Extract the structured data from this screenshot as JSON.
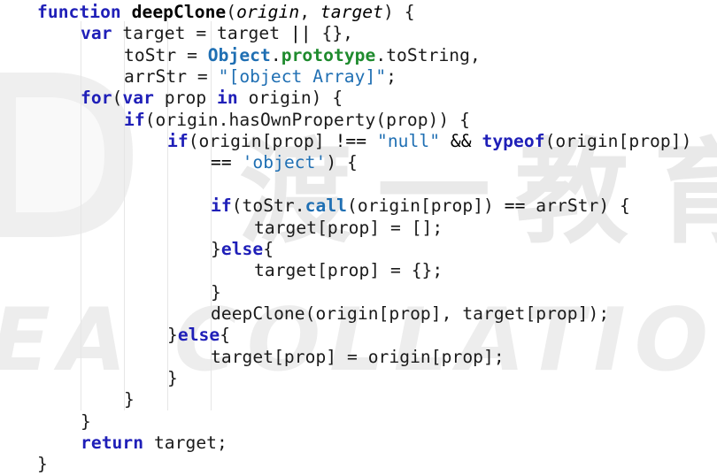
{
  "watermark": {
    "chinese": "渡一教育",
    "latin": "EA COLLATION"
  },
  "colors": {
    "keyword": "#1f1fb8",
    "builtin": "#1f6fb3",
    "property": "#1f8b2e",
    "string": "#1f6fb3",
    "plain": "#1a1a1a"
  },
  "code_lines": [
    {
      "indent": 0,
      "tokens": [
        {
          "t": "function",
          "c": "t-key"
        },
        {
          "t": " ",
          "c": ""
        },
        {
          "t": "deepClone",
          "c": "t-def-name"
        },
        {
          "t": "(",
          "c": ""
        },
        {
          "t": "origin",
          "c": "t-par"
        },
        {
          "t": ", ",
          "c": ""
        },
        {
          "t": "target",
          "c": "t-par"
        },
        {
          "t": ") {",
          "c": ""
        }
      ]
    },
    {
      "indent": 1,
      "tokens": [
        {
          "t": "var",
          "c": "t-key"
        },
        {
          "t": " target = target ",
          "c": ""
        },
        {
          "t": "||",
          "c": "t-op"
        },
        {
          "t": " {},",
          "c": ""
        }
      ]
    },
    {
      "indent": 2,
      "tokens": [
        {
          "t": "toStr = ",
          "c": ""
        },
        {
          "t": "Object",
          "c": "t-obj"
        },
        {
          "t": ".",
          "c": ""
        },
        {
          "t": "prototype",
          "c": "t-prop"
        },
        {
          "t": ".toString,",
          "c": ""
        }
      ]
    },
    {
      "indent": 2,
      "tokens": [
        {
          "t": "arrStr = ",
          "c": ""
        },
        {
          "t": "\"[object Array]\"",
          "c": "t-str"
        },
        {
          "t": ";",
          "c": ""
        }
      ]
    },
    {
      "indent": 1,
      "tokens": [
        {
          "t": "for",
          "c": "t-key"
        },
        {
          "t": "(",
          "c": ""
        },
        {
          "t": "var",
          "c": "t-key"
        },
        {
          "t": " prop ",
          "c": ""
        },
        {
          "t": "in",
          "c": "t-key"
        },
        {
          "t": " origin) {",
          "c": ""
        }
      ]
    },
    {
      "indent": 2,
      "tokens": [
        {
          "t": "if",
          "c": "t-key"
        },
        {
          "t": "(origin.hasOwnProperty(prop)) {",
          "c": ""
        }
      ]
    },
    {
      "indent": 3,
      "tokens": [
        {
          "t": "if",
          "c": "t-key"
        },
        {
          "t": "(origin[prop] ",
          "c": ""
        },
        {
          "t": "!==",
          "c": "t-op"
        },
        {
          "t": " ",
          "c": ""
        },
        {
          "t": "\"null\"",
          "c": "t-str"
        },
        {
          "t": " ",
          "c": ""
        },
        {
          "t": "&&",
          "c": "t-op"
        },
        {
          "t": " ",
          "c": ""
        },
        {
          "t": "typeof",
          "c": "t-key"
        },
        {
          "t": "(origin[prop])",
          "c": ""
        }
      ]
    },
    {
      "indent": 4,
      "tokens": [
        {
          "t": "==",
          "c": "t-op"
        },
        {
          "t": " ",
          "c": ""
        },
        {
          "t": "'object'",
          "c": "t-str"
        },
        {
          "t": ") {",
          "c": ""
        }
      ]
    },
    {
      "indent": 0,
      "tokens": []
    },
    {
      "indent": 4,
      "tokens": [
        {
          "t": "if",
          "c": "t-key"
        },
        {
          "t": "(toStr.",
          "c": ""
        },
        {
          "t": "call",
          "c": "t-obj"
        },
        {
          "t": "(origin[prop]) ",
          "c": ""
        },
        {
          "t": "==",
          "c": "t-op"
        },
        {
          "t": " arrStr) {",
          "c": ""
        }
      ]
    },
    {
      "indent": 5,
      "tokens": [
        {
          "t": "target[prop] = [];",
          "c": ""
        }
      ]
    },
    {
      "indent": 4,
      "tokens": [
        {
          "t": "}",
          "c": ""
        },
        {
          "t": "else",
          "c": "t-key"
        },
        {
          "t": "{",
          "c": ""
        }
      ]
    },
    {
      "indent": 5,
      "tokens": [
        {
          "t": "target[prop] = {};",
          "c": ""
        }
      ]
    },
    {
      "indent": 4,
      "tokens": [
        {
          "t": "}",
          "c": ""
        }
      ]
    },
    {
      "indent": 4,
      "tokens": [
        {
          "t": "deepClone(origin[prop], target[prop]);",
          "c": ""
        }
      ]
    },
    {
      "indent": 3,
      "tokens": [
        {
          "t": "}",
          "c": ""
        },
        {
          "t": "else",
          "c": "t-key"
        },
        {
          "t": "{",
          "c": ""
        }
      ]
    },
    {
      "indent": 4,
      "tokens": [
        {
          "t": "target[prop] = origin[prop];",
          "c": ""
        }
      ]
    },
    {
      "indent": 3,
      "tokens": [
        {
          "t": "}",
          "c": ""
        }
      ]
    },
    {
      "indent": 2,
      "tokens": [
        {
          "t": "}",
          "c": ""
        }
      ]
    },
    {
      "indent": 1,
      "tokens": [
        {
          "t": "}",
          "c": ""
        }
      ]
    },
    {
      "indent": 1,
      "tokens": [
        {
          "t": "return",
          "c": "t-key"
        },
        {
          "t": " target;",
          "c": ""
        }
      ]
    },
    {
      "indent": 0,
      "tokens": [
        {
          "t": "}",
          "c": ""
        }
      ]
    }
  ]
}
